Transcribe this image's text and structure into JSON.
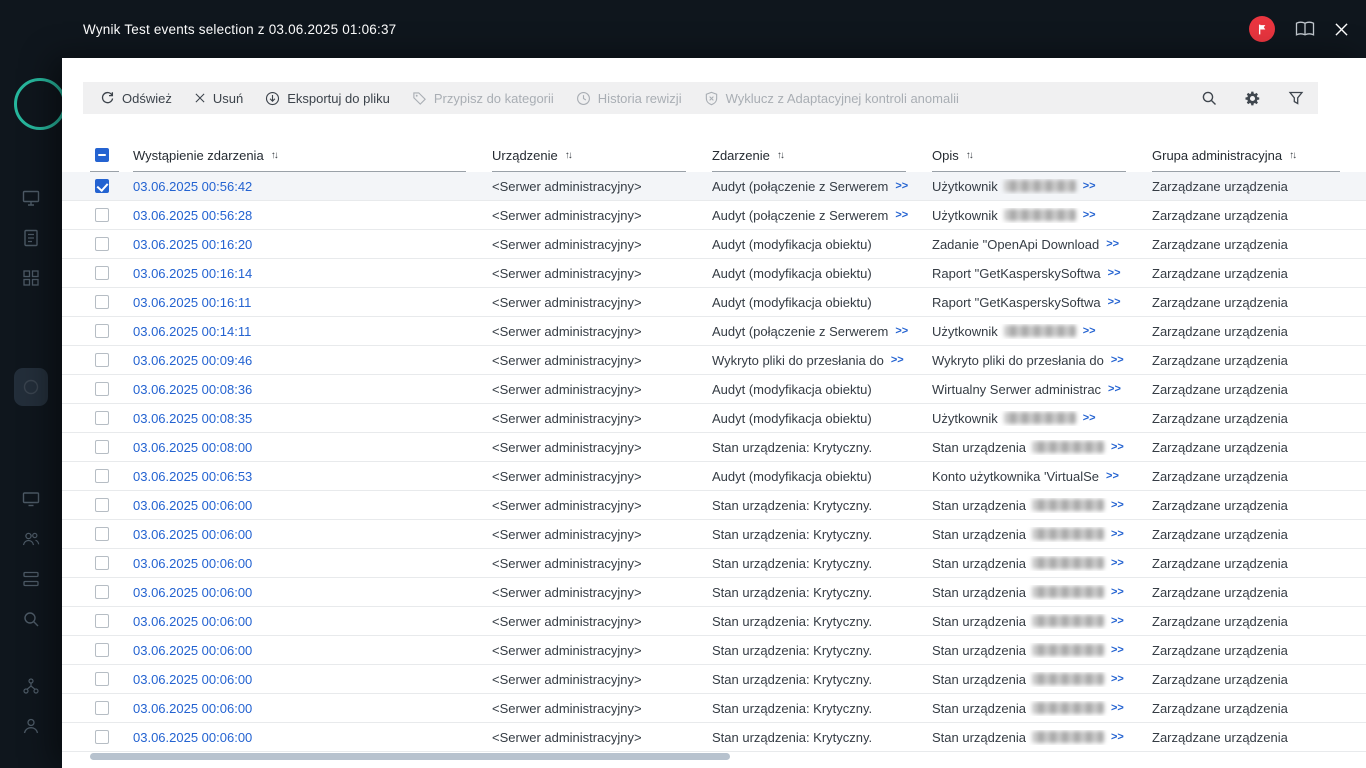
{
  "header": {
    "title": "Wynik Test events selection z 03.06.2025 01:06:37"
  },
  "colors": {
    "accent_blue": "#2463d1",
    "badge_red": "#e9353f",
    "dark_background": "#0f161d",
    "toolbar_gray": "#f0f0f1"
  },
  "toolbar": {
    "buttons": [
      {
        "label": "Odśwież",
        "icon": "refresh-icon",
        "enabled": true
      },
      {
        "label": "Usuń",
        "icon": "delete-icon",
        "enabled": true
      },
      {
        "label": "Eksportuj do pliku",
        "icon": "export-icon",
        "enabled": true
      },
      {
        "label": "Przypisz do kategorii",
        "icon": "category-icon",
        "enabled": false
      },
      {
        "label": "Historia rewizji",
        "icon": "history-icon",
        "enabled": false
      },
      {
        "label": "Wyklucz z Adaptacyjnej kontroli anomalii",
        "icon": "exclude-icon",
        "enabled": false
      }
    ],
    "right_icons": [
      "search-icon",
      "settings-icon",
      "filter-icon"
    ]
  },
  "table": {
    "select_all_state": "indeterminate",
    "more_label": ">>",
    "columns": [
      "Wystąpienie zdarzenia",
      "Urządzenie",
      "Zdarzenie",
      "Opis",
      "Grupa administracyjna"
    ],
    "rows": [
      {
        "time": "03.06.2025 00:56:42",
        "device": "<Serwer administracyjny>",
        "event": "Audyt (połączenie z Serwerem",
        "event_more": true,
        "desc": "Użytkownik",
        "desc_redacted": true,
        "group": "Zarządzane urządzenia",
        "checked": true
      },
      {
        "time": "03.06.2025 00:56:28",
        "device": "<Serwer administracyjny>",
        "event": "Audyt (połączenie z Serwerem",
        "event_more": true,
        "desc": "Użytkownik",
        "desc_redacted": true,
        "group": "Zarządzane urządzenia",
        "checked": false
      },
      {
        "time": "03.06.2025 00:16:20",
        "device": "<Serwer administracyjny>",
        "event": "Audyt (modyfikacja obiektu)",
        "event_more": false,
        "desc": "Zadanie \"OpenApi Download",
        "desc_redacted": false,
        "group": "Zarządzane urządzenia",
        "checked": false
      },
      {
        "time": "03.06.2025 00:16:14",
        "device": "<Serwer administracyjny>",
        "event": "Audyt (modyfikacja obiektu)",
        "event_more": false,
        "desc": "Raport \"GetKasperskySoftwa",
        "desc_redacted": false,
        "group": "Zarządzane urządzenia",
        "checked": false
      },
      {
        "time": "03.06.2025 00:16:11",
        "device": "<Serwer administracyjny>",
        "event": "Audyt (modyfikacja obiektu)",
        "event_more": false,
        "desc": "Raport \"GetKasperskySoftwa",
        "desc_redacted": false,
        "group": "Zarządzane urządzenia",
        "checked": false
      },
      {
        "time": "03.06.2025 00:14:11",
        "device": "<Serwer administracyjny>",
        "event": "Audyt (połączenie z Serwerem",
        "event_more": true,
        "desc": "Użytkownik",
        "desc_redacted": true,
        "group": "Zarządzane urządzenia",
        "checked": false
      },
      {
        "time": "03.06.2025 00:09:46",
        "device": "<Serwer administracyjny>",
        "event": "Wykryto pliki do przesłania do",
        "event_more": true,
        "desc": "Wykryto pliki do przesłania do",
        "desc_redacted": false,
        "group": "Zarządzane urządzenia",
        "checked": false
      },
      {
        "time": "03.06.2025 00:08:36",
        "device": "<Serwer administracyjny>",
        "event": "Audyt (modyfikacja obiektu)",
        "event_more": false,
        "desc": "Wirtualny Serwer administrac",
        "desc_redacted": false,
        "group": "Zarządzane urządzenia",
        "checked": false
      },
      {
        "time": "03.06.2025 00:08:35",
        "device": "<Serwer administracyjny>",
        "event": "Audyt (modyfikacja obiektu)",
        "event_more": false,
        "desc": "Użytkownik",
        "desc_redacted": true,
        "group": "Zarządzane urządzenia",
        "checked": false
      },
      {
        "time": "03.06.2025 00:08:00",
        "device": "<Serwer administracyjny>",
        "event": "Stan urządzenia: Krytyczny.",
        "event_more": false,
        "desc": "Stan urządzenia",
        "desc_redacted": true,
        "group": "Zarządzane urządzenia",
        "checked": false
      },
      {
        "time": "03.06.2025 00:06:53",
        "device": "<Serwer administracyjny>",
        "event": "Audyt (modyfikacja obiektu)",
        "event_more": false,
        "desc": "Konto użytkownika 'VirtualSe",
        "desc_redacted": false,
        "group": "Zarządzane urządzenia",
        "checked": false
      },
      {
        "time": "03.06.2025 00:06:00",
        "device": "<Serwer administracyjny>",
        "event": "Stan urządzenia: Krytyczny.",
        "event_more": false,
        "desc": "Stan urządzenia",
        "desc_redacted": true,
        "group": "Zarządzane urządzenia",
        "checked": false
      },
      {
        "time": "03.06.2025 00:06:00",
        "device": "<Serwer administracyjny>",
        "event": "Stan urządzenia: Krytyczny.",
        "event_more": false,
        "desc": "Stan urządzenia",
        "desc_redacted": true,
        "group": "Zarządzane urządzenia",
        "checked": false
      },
      {
        "time": "03.06.2025 00:06:00",
        "device": "<Serwer administracyjny>",
        "event": "Stan urządzenia: Krytyczny.",
        "event_more": false,
        "desc": "Stan urządzenia",
        "desc_redacted": true,
        "group": "Zarządzane urządzenia",
        "checked": false
      },
      {
        "time": "03.06.2025 00:06:00",
        "device": "<Serwer administracyjny>",
        "event": "Stan urządzenia: Krytyczny.",
        "event_more": false,
        "desc": "Stan urządzenia",
        "desc_redacted": true,
        "group": "Zarządzane urządzenia",
        "checked": false
      },
      {
        "time": "03.06.2025 00:06:00",
        "device": "<Serwer administracyjny>",
        "event": "Stan urządzenia: Krytyczny.",
        "event_more": false,
        "desc": "Stan urządzenia",
        "desc_redacted": true,
        "group": "Zarządzane urządzenia",
        "checked": false
      },
      {
        "time": "03.06.2025 00:06:00",
        "device": "<Serwer administracyjny>",
        "event": "Stan urządzenia: Krytyczny.",
        "event_more": false,
        "desc": "Stan urządzenia",
        "desc_redacted": true,
        "group": "Zarządzane urządzenia",
        "checked": false
      },
      {
        "time": "03.06.2025 00:06:00",
        "device": "<Serwer administracyjny>",
        "event": "Stan urządzenia: Krytyczny.",
        "event_more": false,
        "desc": "Stan urządzenia",
        "desc_redacted": true,
        "group": "Zarządzane urządzenia",
        "checked": false
      },
      {
        "time": "03.06.2025 00:06:00",
        "device": "<Serwer administracyjny>",
        "event": "Stan urządzenia: Krytyczny.",
        "event_more": false,
        "desc": "Stan urządzenia",
        "desc_redacted": true,
        "group": "Zarządzane urządzenia",
        "checked": false
      },
      {
        "time": "03.06.2025 00:06:00",
        "device": "<Serwer administracyjny>",
        "event": "Stan urządzenia: Krytyczny.",
        "event_more": false,
        "desc": "Stan urządzenia",
        "desc_redacted": true,
        "group": "Zarządzane urządzenia",
        "checked": false
      }
    ]
  }
}
